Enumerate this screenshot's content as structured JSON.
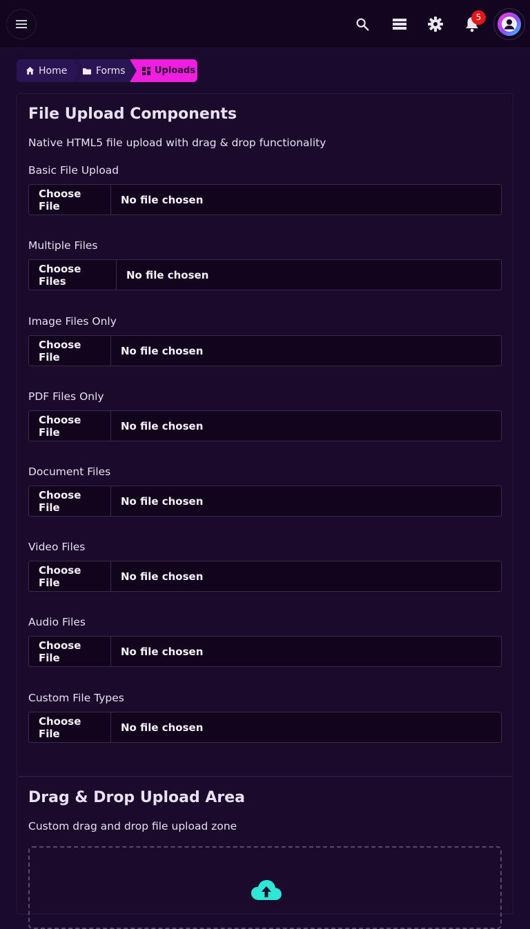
{
  "topbar": {
    "menu_icon": "hamburger-menu-icon",
    "search_icon": "search-icon",
    "layers_icon": "stack-icon",
    "settings_icon": "gear-icon",
    "notifications_icon": "bell-icon",
    "notification_count": "5",
    "avatar_icon": "user-avatar-icon"
  },
  "breadcrumb": {
    "home": "Home",
    "forms": "Forms",
    "current": "Uploads"
  },
  "file_upload_card": {
    "title": "File Upload Components",
    "description": "Native HTML5 file upload with drag & drop functionality",
    "fields": [
      {
        "label": "Basic File Upload",
        "button": "Choose File",
        "status": "No file chosen"
      },
      {
        "label": "Multiple Files",
        "button": "Choose Files",
        "status": "No file chosen"
      },
      {
        "label": "Image Files Only",
        "button": "Choose File",
        "status": "No file chosen"
      },
      {
        "label": "PDF Files Only",
        "button": "Choose File",
        "status": "No file chosen"
      },
      {
        "label": "Document Files",
        "button": "Choose File",
        "status": "No file chosen"
      },
      {
        "label": "Video Files",
        "button": "Choose File",
        "status": "No file chosen"
      },
      {
        "label": "Audio Files",
        "button": "Choose File",
        "status": "No file chosen"
      },
      {
        "label": "Custom File Types",
        "button": "Choose File",
        "status": "No file chosen"
      }
    ]
  },
  "drag_drop_card": {
    "title": "Drag & Drop Upload Area",
    "description": "Custom drag and drop file upload zone",
    "icon": "cloud-upload-icon"
  },
  "colors": {
    "background": "#1a0b2e",
    "accent": "#f01fe0",
    "badge": "#e0181c",
    "upload_icon": "#2ee6d6"
  }
}
